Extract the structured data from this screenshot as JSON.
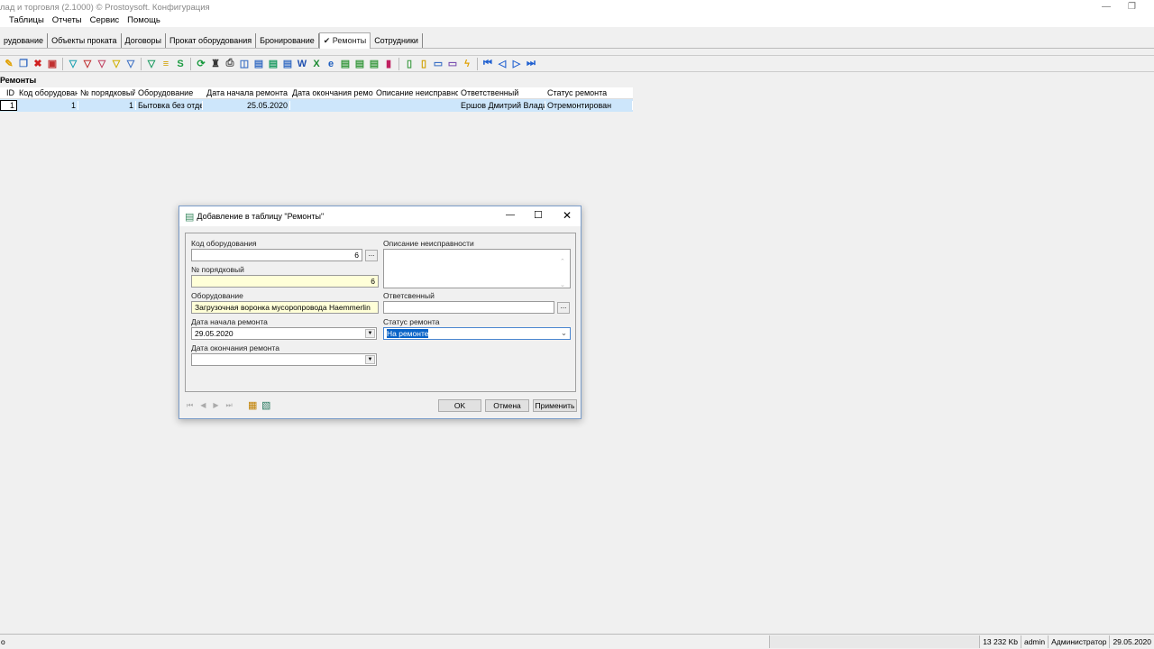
{
  "window": {
    "title": "лад и торговля (2.1000) © Prostoysoft. Конфигурация"
  },
  "menu": [
    "Таблицы",
    "Отчеты",
    "Сервис",
    "Помощь"
  ],
  "tabs": [
    {
      "label": "рудование"
    },
    {
      "label": "Объекты проката"
    },
    {
      "label": "Договоры"
    },
    {
      "label": "Прокат оборудования"
    },
    {
      "label": "Бронирование"
    },
    {
      "label": "✔ Ремонты",
      "active": true
    },
    {
      "label": "Сотрудники"
    }
  ],
  "toolbar_icons": [
    {
      "name": "edit-icon",
      "g": "✎",
      "c": "#e0a000"
    },
    {
      "name": "copy-icon",
      "g": "❐",
      "c": "#3a6fc4"
    },
    {
      "name": "delete-icon",
      "g": "✖",
      "c": "#d02020"
    },
    {
      "name": "delete-all-icon",
      "g": "▣",
      "c": "#c03030"
    },
    "sep",
    {
      "name": "filter-icon",
      "g": "▽",
      "c": "#1aa0b0"
    },
    {
      "name": "filter-remove-icon",
      "g": "▽",
      "c": "#c03030"
    },
    {
      "name": "filter-clear-icon",
      "g": "▽",
      "c": "#c04060"
    },
    {
      "name": "filter-yellow-icon",
      "g": "▽",
      "c": "#d0b000"
    },
    {
      "name": "filter-edit-icon",
      "g": "▽",
      "c": "#3a6fc4"
    },
    "sep",
    {
      "name": "filter-apply-icon",
      "g": "▽",
      "c": "#1a9a60"
    },
    {
      "name": "group-icon",
      "g": "≡",
      "c": "#d0a000"
    },
    {
      "name": "sql-icon",
      "g": "S",
      "c": "#1a9a40"
    },
    "sep",
    {
      "name": "refresh-icon",
      "g": "⟳",
      "c": "#1a9a40"
    },
    {
      "name": "find-icon",
      "g": "♜",
      "c": "#333"
    },
    {
      "name": "print-icon",
      "g": "⎙",
      "c": "#444"
    },
    {
      "name": "preview-icon",
      "g": "◫",
      "c": "#3a6fc4"
    },
    {
      "name": "export-icon",
      "g": "▤",
      "c": "#3a6fc4"
    },
    {
      "name": "export2-icon",
      "g": "▤",
      "c": "#1a9a60"
    },
    {
      "name": "export3-icon",
      "g": "▤",
      "c": "#3a6fc4"
    },
    {
      "name": "word-icon",
      "g": "W",
      "c": "#2050b0"
    },
    {
      "name": "excel-icon",
      "g": "X",
      "c": "#1a8a30"
    },
    {
      "name": "html-icon",
      "g": "e",
      "c": "#2060c0"
    },
    {
      "name": "xml-icon",
      "g": "▤",
      "c": "#3a9a40"
    },
    {
      "name": "dbf-icon",
      "g": "▤",
      "c": "#3a9a40"
    },
    {
      "name": "csv-icon",
      "g": "▤",
      "c": "#3a9a40"
    },
    {
      "name": "chart-icon",
      "g": "▮",
      "c": "#c02060"
    },
    "sep",
    {
      "name": "doc-new-icon",
      "g": "▯",
      "c": "#3a9a40"
    },
    {
      "name": "doc-edit-icon",
      "g": "▯",
      "c": "#d0a000"
    },
    {
      "name": "card-icon",
      "g": "▭",
      "c": "#3a6fc4"
    },
    {
      "name": "card2-icon",
      "g": "▭",
      "c": "#7a50b0"
    },
    {
      "name": "lightning-icon",
      "g": "ϟ",
      "c": "#e0a000"
    },
    "sep",
    {
      "name": "first-record-icon",
      "g": "⏮",
      "c": "#2060d0"
    },
    {
      "name": "prev-record-icon",
      "g": "◁",
      "c": "#2060d0"
    },
    {
      "name": "next-record-icon",
      "g": "▷",
      "c": "#2060d0"
    },
    {
      "name": "last-record-icon",
      "g": "⏭",
      "c": "#2060d0"
    }
  ],
  "grid": {
    "title": "Ремонты",
    "columns": [
      "ID",
      "Код оборудования",
      "№ порядковый",
      "Оборудование",
      "Дата начала ремонта",
      "Дата окончания ремонта",
      "Описание неисправности",
      "Ответственный",
      "Статус ремонта"
    ],
    "rows": [
      [
        "1",
        "1",
        "1",
        "Бытовка без отделк",
        "25.05.2020",
        "",
        "",
        "Ершов Дмитрий Владимир",
        "Отремонтирован"
      ]
    ]
  },
  "dialog": {
    "title": "Добавление в таблицу \"Ремонты\"",
    "fields": {
      "code_label": "Код оборудования",
      "code_value": "6",
      "seq_label": "№ порядковый",
      "seq_value": "6",
      "equip_label": "Оборудование",
      "equip_value": "Загрузочная воронка мусоропровода Haemmerlin",
      "start_label": "Дата начала ремонта",
      "start_value": "29.05.2020",
      "end_label": "Дата окончания ремонта",
      "end_value": "",
      "desc_label": "Описание неисправности",
      "desc_value": "",
      "resp_label": "Ответсвенный",
      "resp_value": "",
      "status_label": "Статус ремонта",
      "status_value": "На ремонте"
    },
    "ellipsis": "...",
    "ok": "OK",
    "cancel": "Отмена",
    "apply": "Применить"
  },
  "status": {
    "left": "о",
    "memory": "13 232 Kb",
    "user": "admin",
    "role": "Администратор",
    "date": "29.05.2020"
  }
}
